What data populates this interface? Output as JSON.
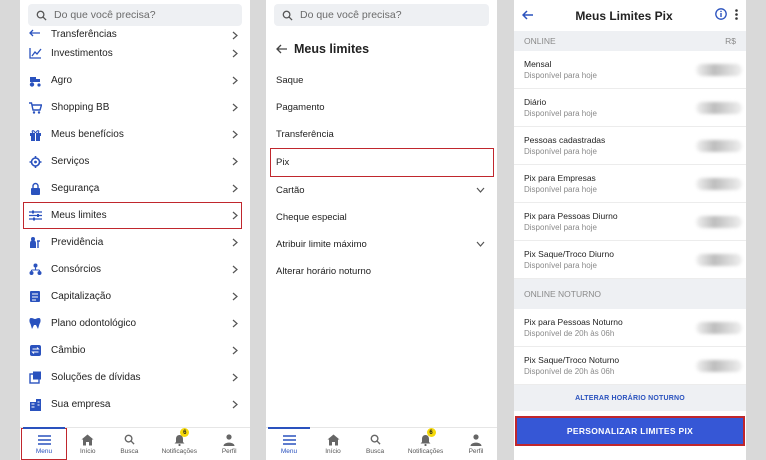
{
  "search": {
    "placeholder": "Do que você precisa?"
  },
  "panel1": {
    "items": [
      {
        "label": "Transferências",
        "icon": "transfer-icon"
      },
      {
        "label": "Investimentos",
        "icon": "chart-icon"
      },
      {
        "label": "Agro",
        "icon": "tractor-icon"
      },
      {
        "label": "Shopping BB",
        "icon": "cart-icon"
      },
      {
        "label": "Meus benefícios",
        "icon": "gift-icon"
      },
      {
        "label": "Serviços",
        "icon": "services-icon"
      },
      {
        "label": "Segurança",
        "icon": "lock-icon"
      },
      {
        "label": "Meus limites",
        "icon": "limits-icon"
      },
      {
        "label": "Previdência",
        "icon": "pension-icon"
      },
      {
        "label": "Consórcios",
        "icon": "consortium-icon"
      },
      {
        "label": "Capitalização",
        "icon": "capitalization-icon"
      },
      {
        "label": "Plano odontológico",
        "icon": "tooth-icon"
      },
      {
        "label": "Câmbio",
        "icon": "exchange-icon"
      },
      {
        "label": "Soluções de dívidas",
        "icon": "debt-icon"
      },
      {
        "label": "Sua empresa",
        "icon": "company-icon"
      }
    ]
  },
  "nav": {
    "menu": "Menu",
    "inicio": "Início",
    "busca": "Busca",
    "notificacoes": "Notificações",
    "perfil": "Perfil",
    "badge": "6"
  },
  "panel2": {
    "title": "Meus limites",
    "items": [
      {
        "label": "Saque"
      },
      {
        "label": "Pagamento"
      },
      {
        "label": "Transferência"
      },
      {
        "label": "Pix"
      },
      {
        "label": "Cartão"
      },
      {
        "label": "Cheque especial"
      },
      {
        "label": "Atribuir limite máximo"
      },
      {
        "label": "Alterar horário noturno"
      }
    ]
  },
  "panel3": {
    "title": "Meus Limites Pix",
    "section_online": "ONLINE",
    "currency": "R$",
    "online_rows": [
      {
        "name": "Mensal",
        "sub": "Disponível para hoje"
      },
      {
        "name": "Diário",
        "sub": "Disponível para hoje"
      },
      {
        "name": "Pessoas cadastradas",
        "sub": "Disponível para hoje"
      },
      {
        "name": "Pix para Empresas",
        "sub": "Disponível para hoje"
      },
      {
        "name": "Pix para Pessoas Diurno",
        "sub": "Disponível para hoje"
      },
      {
        "name": "Pix Saque/Troco Diurno",
        "sub": "Disponível para hoje"
      }
    ],
    "section_night": "ONLINE NOTURNO",
    "night_rows": [
      {
        "name": "Pix para Pessoas Noturno",
        "sub": "Disponível de 20h às 06h"
      },
      {
        "name": "Pix Saque/Troco Noturno",
        "sub": "Disponível de 20h às 06h"
      }
    ],
    "link": "ALTERAR HORÁRIO NOTURNO",
    "cta": "PERSONALIZAR LIMITES PIX"
  },
  "colors": {
    "accent": "#2a52be",
    "highlight": "#c0272d",
    "cta": "#3657d6",
    "badge": "#f5d90a"
  }
}
